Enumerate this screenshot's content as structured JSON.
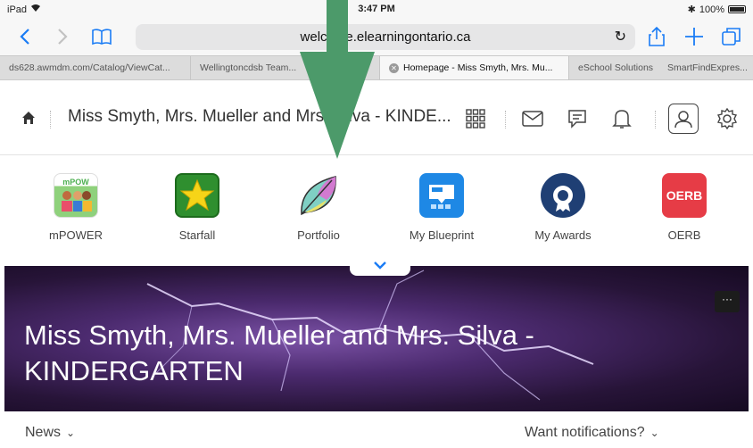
{
  "status": {
    "device": "iPad",
    "time": "3:47 PM",
    "battery": "100%"
  },
  "browser": {
    "url": "welcome.elearningontario.ca",
    "tabs": [
      {
        "label": "ds628.awmdm.com/Catalog/ViewCat..."
      },
      {
        "label": "Wellingtoncdsb Team..."
      },
      {
        "label": "Homepage - Miss Smyth, Mrs. Mu..."
      },
      {
        "label": "eSchool Solutions"
      },
      {
        "label": "SmartFindExpres..."
      }
    ]
  },
  "course_nav": {
    "title": "Miss Smyth, Mrs. Mueller and Mrs. Silva - KINDE..."
  },
  "apps": [
    {
      "label": "mPOWER"
    },
    {
      "label": "Starfall"
    },
    {
      "label": "Portfolio"
    },
    {
      "label": "My Blueprint"
    },
    {
      "label": "My Awards"
    },
    {
      "label": "OERB"
    }
  ],
  "banner": {
    "title": "Miss Smyth, Mrs. Mueller and Mrs. Silva - KINDERGARTEN",
    "more": "···"
  },
  "footer": {
    "news": "News",
    "notifications": "Want notifications?"
  },
  "colors": {
    "accent": "#1a7cf5",
    "arrow": "#4c9a6a",
    "banner": "#4b2a6e"
  }
}
